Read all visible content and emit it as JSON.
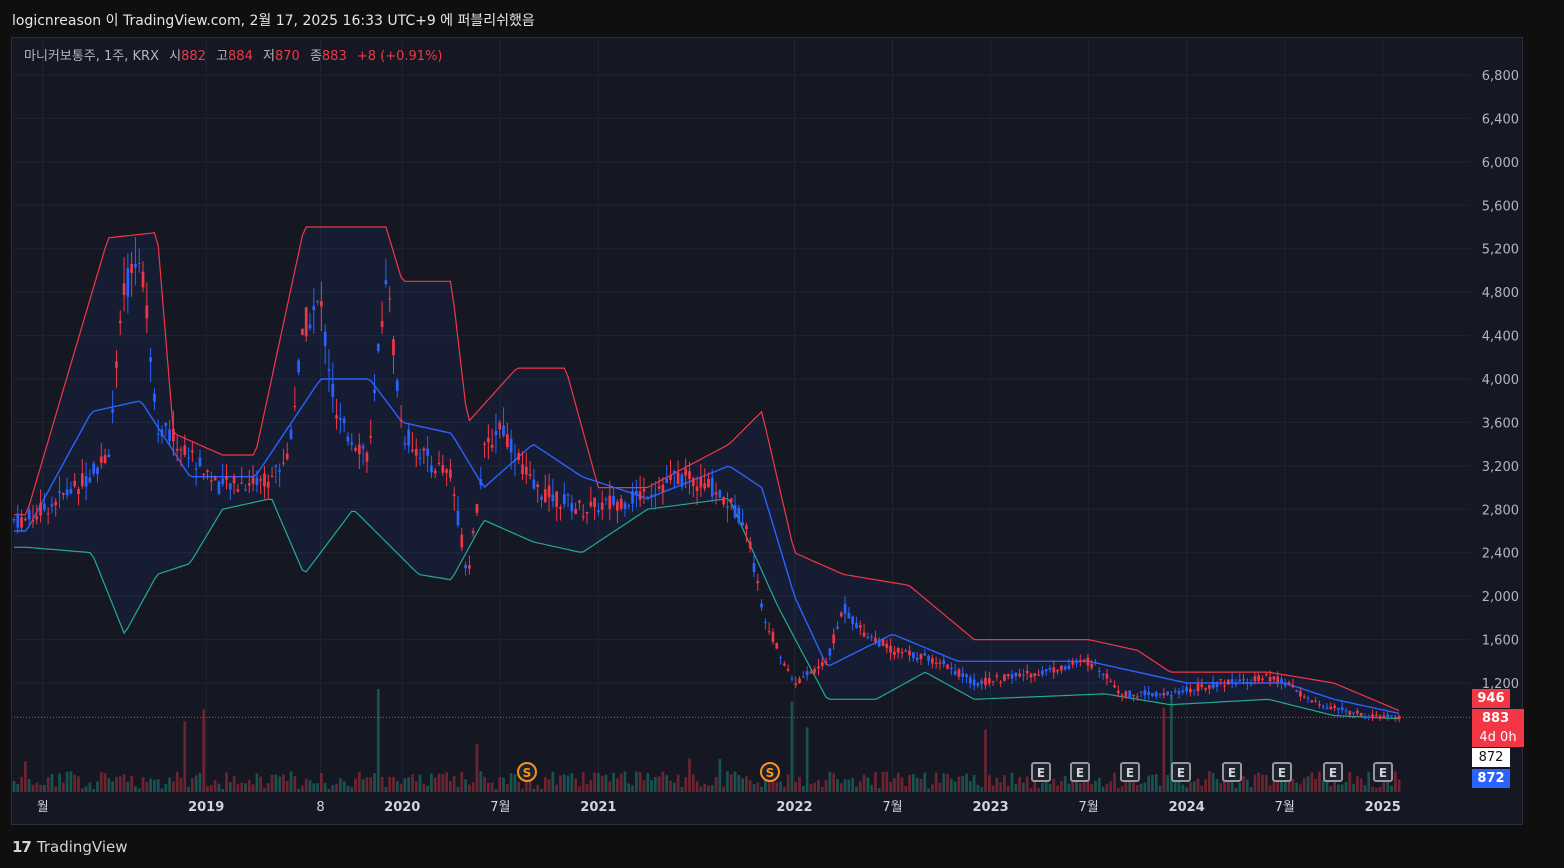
{
  "header": {
    "title": "logicnreason 이 TradingView.com, 2월 17, 2025 16:33 UTC+9 에 퍼블리쉬했음"
  },
  "legend": {
    "symbol": "마니커보통주, 1주, KRX",
    "open_label": "시",
    "open": "882",
    "high_label": "고",
    "high": "884",
    "low_label": "저",
    "low": "870",
    "close_label": "종",
    "close": "883",
    "change": "+8 (+0.91%)"
  },
  "footer": {
    "brand": "TradingView",
    "logo_glyph": "17"
  },
  "price_tags": {
    "upper": "946",
    "close": "883",
    "countdown": "4d 0h",
    "low": "872",
    "basis": "872"
  },
  "events": {
    "splits": [
      "S",
      "S"
    ],
    "earnings": [
      "E",
      "E",
      "E",
      "E",
      "E",
      "E",
      "E",
      "E"
    ]
  },
  "colors": {
    "up": "#f23645",
    "down": "#2962ff",
    "upper_band": "#f23645",
    "lower_band": "#22ab94",
    "basis": "#2962ff",
    "background": "#151823"
  },
  "chart_data": {
    "type": "candlestick",
    "interval": "1W",
    "ylim": [
      1000,
      6800
    ],
    "y_ticks": [
      6800,
      6400,
      6000,
      5600,
      5200,
      4800,
      4400,
      4000,
      3600,
      3200,
      2800,
      2400,
      2000,
      1600,
      1200
    ],
    "y_tick_labels": [
      "6,800",
      "6,400",
      "6,000",
      "5,600",
      "5,200",
      "4,800",
      "4,400",
      "4,000",
      "3,600",
      "3,200",
      "2,800",
      "2,400",
      "2,000",
      "1,600",
      "1,200"
    ],
    "x_tick_labels": [
      "월",
      "2019",
      "8",
      "2020",
      "7월",
      "2021",
      "2022",
      "7월",
      "2023",
      "7월",
      "2024",
      "7월",
      "2025"
    ],
    "x_tick_dates": [
      "2018-03",
      "2019-01",
      "2019-08",
      "2020-01",
      "2020-07",
      "2021-01",
      "2022-01",
      "2022-07",
      "2023-01",
      "2023-07",
      "2024-01",
      "2024-07",
      "2025-01"
    ],
    "time_range": [
      "2018-02",
      "2025-02"
    ],
    "grid": true,
    "close_anchors": [
      [
        "2018-02",
        2700
      ],
      [
        "2018-05",
        3000
      ],
      [
        "2018-07",
        3300
      ],
      [
        "2018-08",
        4800
      ],
      [
        "2018-09",
        5200
      ],
      [
        "2018-10",
        3600
      ],
      [
        "2018-12",
        3300
      ],
      [
        "2019-02",
        3000
      ],
      [
        "2019-05",
        3100
      ],
      [
        "2019-06",
        3300
      ],
      [
        "2019-07",
        4500
      ],
      [
        "2019-08",
        4700
      ],
      [
        "2019-09",
        3600
      ],
      [
        "2019-11",
        3300
      ],
      [
        "2019-12",
        5000
      ],
      [
        "2020-01",
        3500
      ],
      [
        "2020-03",
        3200
      ],
      [
        "2020-04",
        3100
      ],
      [
        "2020-05",
        2200
      ],
      [
        "2020-06",
        3300
      ],
      [
        "2020-07",
        3600
      ],
      [
        "2020-09",
        3000
      ],
      [
        "2020-12",
        2800
      ],
      [
        "2021-03",
        2900
      ],
      [
        "2021-06",
        3100
      ],
      [
        "2021-08",
        3000
      ],
      [
        "2021-10",
        2700
      ],
      [
        "2021-11",
        1900
      ],
      [
        "2021-12",
        1500
      ],
      [
        "2022-01",
        1200
      ],
      [
        "2022-03",
        1400
      ],
      [
        "2022-04",
        1900
      ],
      [
        "2022-05",
        1700
      ],
      [
        "2022-07",
        1500
      ],
      [
        "2022-10",
        1400
      ],
      [
        "2022-12",
        1200
      ],
      [
        "2023-04",
        1300
      ],
      [
        "2023-07",
        1400
      ],
      [
        "2023-08",
        1300
      ],
      [
        "2023-09",
        1100
      ],
      [
        "2023-12",
        1100
      ],
      [
        "2024-03",
        1200
      ],
      [
        "2024-06",
        1250
      ],
      [
        "2024-07",
        1200
      ],
      [
        "2024-09",
        1000
      ],
      [
        "2024-12",
        900
      ],
      [
        "2025-02",
        883
      ]
    ],
    "bollinger_upper_anchors": [
      [
        "2018-02",
        2750
      ],
      [
        "2018-07",
        5300
      ],
      [
        "2018-10",
        5350
      ],
      [
        "2018-11",
        3500
      ],
      [
        "2019-02",
        3300
      ],
      [
        "2019-04",
        3300
      ],
      [
        "2019-07",
        5400
      ],
      [
        "2019-12",
        5400
      ],
      [
        "2020-01",
        4900
      ],
      [
        "2020-04",
        4900
      ],
      [
        "2020-05",
        3600
      ],
      [
        "2020-08",
        4100
      ],
      [
        "2020-11",
        4100
      ],
      [
        "2021-01",
        3000
      ],
      [
        "2021-04",
        3000
      ],
      [
        "2021-09",
        3400
      ],
      [
        "2021-11",
        3700
      ],
      [
        "2022-01",
        2400
      ],
      [
        "2022-04",
        2200
      ],
      [
        "2022-08",
        2100
      ],
      [
        "2022-12",
        1600
      ],
      [
        "2023-07",
        1600
      ],
      [
        "2023-10",
        1500
      ],
      [
        "2023-12",
        1300
      ],
      [
        "2024-06",
        1300
      ],
      [
        "2024-10",
        1200
      ],
      [
        "2025-02",
        946
      ]
    ],
    "bollinger_lower_anchors": [
      [
        "2018-02",
        2450
      ],
      [
        "2018-06",
        2400
      ],
      [
        "2018-08",
        1650
      ],
      [
        "2018-10",
        2200
      ],
      [
        "2018-12",
        2300
      ],
      [
        "2019-02",
        2800
      ],
      [
        "2019-05",
        2900
      ],
      [
        "2019-07",
        2200
      ],
      [
        "2019-10",
        2800
      ],
      [
        "2020-02",
        2200
      ],
      [
        "2020-04",
        2150
      ],
      [
        "2020-06",
        2700
      ],
      [
        "2020-09",
        2500
      ],
      [
        "2020-12",
        2400
      ],
      [
        "2021-04",
        2800
      ],
      [
        "2021-09",
        2900
      ],
      [
        "2021-12",
        1900
      ],
      [
        "2022-03",
        1050
      ],
      [
        "2022-06",
        1050
      ],
      [
        "2022-09",
        1300
      ],
      [
        "2022-12",
        1050
      ],
      [
        "2023-08",
        1100
      ],
      [
        "2023-12",
        1000
      ],
      [
        "2024-06",
        1050
      ],
      [
        "2024-10",
        900
      ],
      [
        "2025-02",
        872
      ]
    ],
    "bollinger_basis_anchors": [
      [
        "2018-02",
        2600
      ],
      [
        "2018-06",
        3700
      ],
      [
        "2018-09",
        3800
      ],
      [
        "2018-12",
        3100
      ],
      [
        "2019-04",
        3100
      ],
      [
        "2019-08",
        4000
      ],
      [
        "2019-11",
        4000
      ],
      [
        "2020-01",
        3600
      ],
      [
        "2020-04",
        3500
      ],
      [
        "2020-06",
        3000
      ],
      [
        "2020-09",
        3400
      ],
      [
        "2020-12",
        3100
      ],
      [
        "2021-04",
        2900
      ],
      [
        "2021-09",
        3200
      ],
      [
        "2021-11",
        3000
      ],
      [
        "2022-01",
        2000
      ],
      [
        "2022-03",
        1350
      ],
      [
        "2022-05",
        1500
      ],
      [
        "2022-07",
        1650
      ],
      [
        "2022-11",
        1400
      ],
      [
        "2023-07",
        1400
      ],
      [
        "2023-10",
        1300
      ],
      [
        "2024-01",
        1200
      ],
      [
        "2024-07",
        1200
      ],
      [
        "2024-10",
        1050
      ],
      [
        "2025-02",
        920
      ]
    ]
  }
}
